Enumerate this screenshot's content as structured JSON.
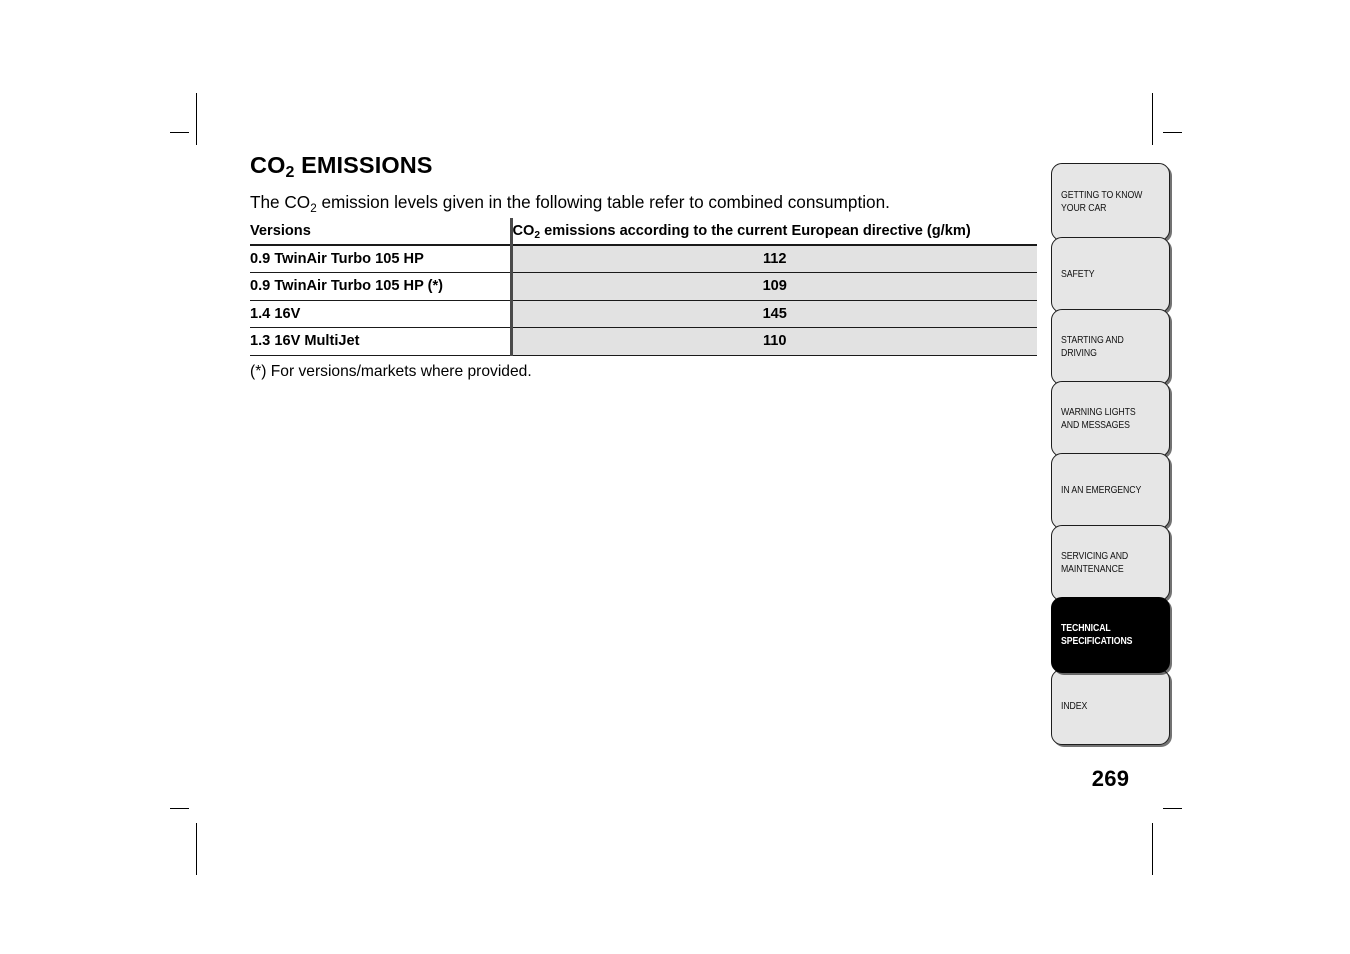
{
  "document": {
    "page_number": "269",
    "title_pre": "CO",
    "title_sub": "2",
    "title_post": " EMISSIONS",
    "intro_pre": "The CO",
    "intro_sub": "2",
    "intro_post": " emission levels given in the following table refer to combined consumption.",
    "footnote": "(*) For versions/markets where provided."
  },
  "table": {
    "header": {
      "versions": "Versions",
      "emissions_pre": "CO",
      "emissions_sub": "2",
      "emissions_post": " emissions according to the current European directive (g/km)"
    },
    "rows": [
      {
        "version": "0.9 TwinAir Turbo 105 HP",
        "co2": "112"
      },
      {
        "version": "0.9 TwinAir Turbo 105 HP (*)",
        "co2": "109"
      },
      {
        "version": "1.4 16V",
        "co2": "145"
      },
      {
        "version": "1.3 16V MultiJet",
        "co2": "110"
      }
    ]
  },
  "chart_data": {
    "type": "table",
    "title": "CO2 EMISSIONS",
    "columns": [
      "Versions",
      "CO2 emissions according to the current European directive (g/km)"
    ],
    "categories": [
      "0.9 TwinAir Turbo 105 HP",
      "0.9 TwinAir Turbo 105 HP (*)",
      "1.4 16V",
      "1.3 16V MultiJet"
    ],
    "values": [
      112,
      109,
      145,
      110
    ],
    "xlabel": "Versions",
    "ylabel": "CO2 emissions (g/km)",
    "note": "(*) For versions/markets where provided."
  },
  "section_tabs": {
    "active_index": 6,
    "items": [
      {
        "label": "GETTING TO KNOW\nYOUR CAR",
        "active": false
      },
      {
        "label": "SAFETY",
        "active": false
      },
      {
        "label": "STARTING AND\nDRIVING",
        "active": false
      },
      {
        "label": "WARNING LIGHTS\nAND MESSAGES",
        "active": false
      },
      {
        "label": "IN AN EMERGENCY",
        "active": false
      },
      {
        "label": "SERVICING AND\nMAINTENANCE",
        "active": false
      },
      {
        "label": "TECHNICAL\nSPECIFICATIONS",
        "active": true
      },
      {
        "label": "INDEX",
        "active": false
      }
    ]
  },
  "colors": {
    "cell_fill": "#e2e2e2",
    "tab_fill": "#e6e6e6",
    "tab_active_fill": "#000000",
    "rule": "#1a1a1a",
    "divider": "#4a4a4a"
  }
}
